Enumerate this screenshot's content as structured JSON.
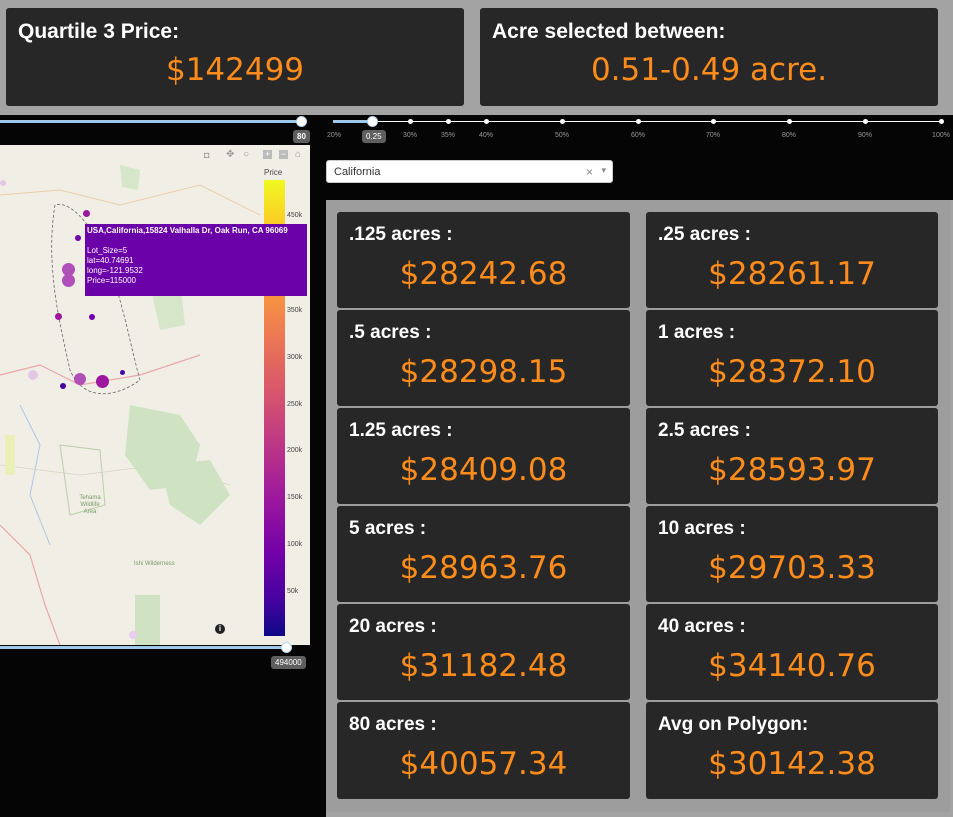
{
  "top_cards": {
    "quartile": {
      "label": "Quartile 3 Price:",
      "value": "$142499"
    },
    "acre_range": {
      "label": "Acre selected between:",
      "value": "0.51-0.49 acre."
    }
  },
  "left_slider": {
    "value": "80"
  },
  "bottom_slider": {
    "value": "494000"
  },
  "acre_slider": {
    "ticks": [
      "20%",
      "30%",
      "35%",
      "40%",
      "50%",
      "60%",
      "70%",
      "80%",
      "90%",
      "100%"
    ],
    "selected_label": "0.25"
  },
  "state_dropdown": {
    "value": "California",
    "clear": "×",
    "arrow": "▾"
  },
  "map": {
    "colorbar_title": "Price",
    "colorbar_ticks": [
      "450k",
      "400k",
      "350k",
      "300k",
      "250k",
      "200k",
      "150k",
      "100k",
      "50k"
    ],
    "colorbar_range": [
      0,
      494000
    ],
    "hover": {
      "line1": "USA,California,15824 Valhalla Dr, Oak Run, CA 96069",
      "line2": "Lot_Size=5",
      "line3": "lat=40.74691",
      "line4": "long=-121.9532",
      "line5": "Price=115000"
    },
    "labels": {
      "wildlife": "Tehama Wildlife Area",
      "wilderness": "Ishi Wilderness"
    },
    "info": "i",
    "toolbar_icons": [
      "camera-icon",
      "pan-icon",
      "lasso-icon",
      "zoom-in-icon",
      "zoom-out-icon",
      "home-icon"
    ]
  },
  "price_cards": [
    {
      "label": ".125 acres :",
      "value": "$28242.68"
    },
    {
      "label": ".25 acres :",
      "value": "$28261.17"
    },
    {
      "label": ".5 acres :",
      "value": "$28298.15"
    },
    {
      "label": "1 acres :",
      "value": "$28372.10"
    },
    {
      "label": "1.25 acres :",
      "value": "$28409.08"
    },
    {
      "label": "2.5 acres :",
      "value": "$28593.97"
    },
    {
      "label": "5 acres :",
      "value": "$28963.76"
    },
    {
      "label": "10 acres :",
      "value": "$29703.33"
    },
    {
      "label": "20 acres :",
      "value": "$31182.48"
    },
    {
      "label": "40 acres :",
      "value": "$34140.76"
    },
    {
      "label": "80 acres :",
      "value": "$40057.34"
    },
    {
      "label": "Avg on Polygon:",
      "value": "$30142.38"
    }
  ],
  "colors": {
    "accent": "#ff8c1a",
    "card": "#272727",
    "slider": "#9ec9ea"
  }
}
